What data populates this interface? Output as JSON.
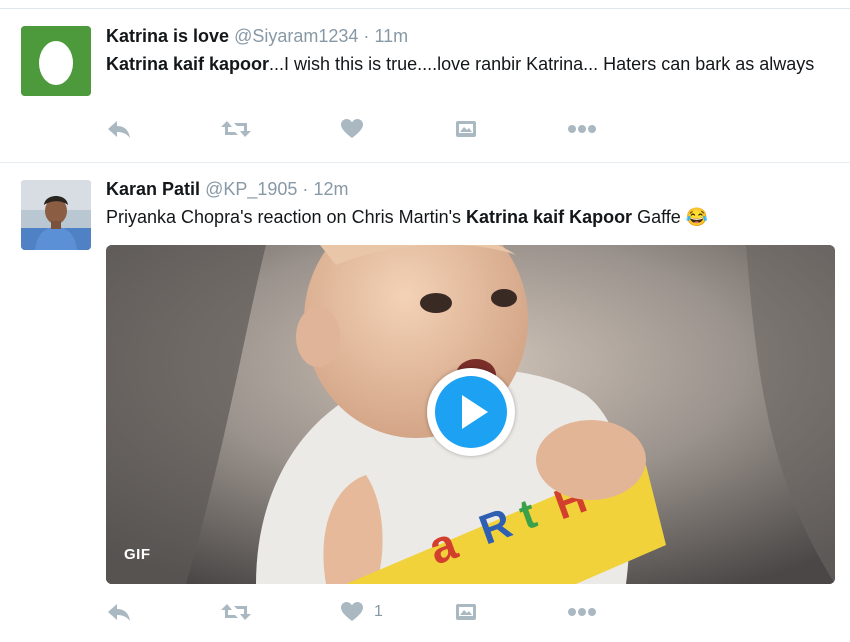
{
  "tweets": [
    {
      "author_name": "Katrina is love",
      "handle": "@Siyaram1234",
      "separator": "·",
      "time": "11m",
      "text_bold": "Katrina kaif kapoor",
      "text_rest": "...I wish this is true....love ranbir Katrina... Haters can bark as always",
      "actions": {
        "reply": "reply-icon",
        "retweet": "retweet-icon",
        "like": "heart-icon",
        "more": "more-dots-icon",
        "moment": "moment-icon"
      }
    },
    {
      "author_name": "Karan Patil",
      "handle": "@KP_1905",
      "separator": "·",
      "time": "12m",
      "text_before": "Priyanka Chopra's reaction on Chris Martin's ",
      "text_bold": "Katrina kaif Kapoor",
      "text_after": " Gaffe ",
      "emoji": "😂",
      "media_badge": "GIF",
      "like_count": "1",
      "actions": {
        "reply": "reply-icon",
        "retweet": "retweet-icon",
        "like": "heart-icon",
        "more": "more-dots-icon",
        "moment": "moment-icon"
      }
    }
  ],
  "colors": {
    "accent": "#1da1f2",
    "muted": "#8899a6",
    "icon": "#aab8c2",
    "egg_green": "#4c9a3c"
  }
}
